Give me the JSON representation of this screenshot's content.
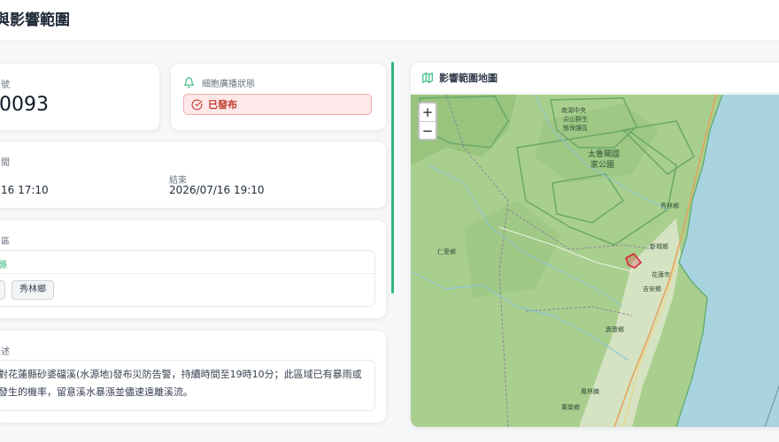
{
  "page": {
    "title": "與影響範圍"
  },
  "alert_id": {
    "label": "號",
    "value": "0093"
  },
  "broadcast": {
    "label": "細胞廣播狀態",
    "status": "已發布"
  },
  "time": {
    "label": "間",
    "start": "16 17:10",
    "end_label": "結束",
    "end": "2026/07/16 19:10"
  },
  "area": {
    "label": "區",
    "county": "縣",
    "towns": [
      "",
      "秀林鄉"
    ]
  },
  "description": {
    "label": "述",
    "line1": "對花蓮縣砂婆礑溪(水源地)發布災防告警，持續時間至19時10分；此區域已有暴雨或",
    "line2": "發生的機率，留意溪水暴漲並儘速遠離溪流。"
  },
  "map": {
    "title": "影響範圍地圖",
    "zoom_in": "+",
    "zoom_out": "−",
    "labels": {
      "l1": "太魯閣國",
      "l2": "家公園",
      "l3": "南湖中央",
      "l4": "尖山群生",
      "l5": "態保護區",
      "l6": "秀林鄉",
      "l7": "新城鄉",
      "l8": "花蓮市",
      "l9": "吉安鄉",
      "l10": "壽豐鄉",
      "l11": "仁愛鄉",
      "l12": "鳳林鎮",
      "l13": "萬榮鄉"
    }
  },
  "colors": {
    "accent_green": "#2fb67a",
    "alert_red": "#c0392b",
    "alert_bg": "#fde8ea",
    "land": "#a9cf8e",
    "sea": "#a9d3df"
  }
}
